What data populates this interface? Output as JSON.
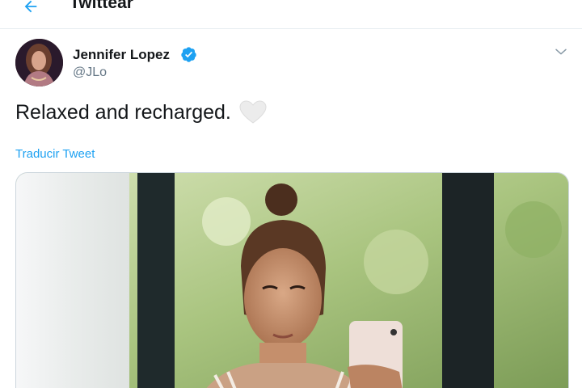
{
  "header": {
    "title": "Twittear",
    "back_icon": "arrow-left-icon"
  },
  "tweet": {
    "author": {
      "name": "Jennifer Lopez",
      "handle": "@JLo",
      "verified": true
    },
    "text": "Relaxed and recharged.",
    "emoji": "white-heart-icon",
    "translate_label": "Traducir Tweet",
    "menu_icon": "chevron-down-icon",
    "media_description": "photo"
  },
  "colors": {
    "accent": "#1da1f2",
    "handle": "#657786",
    "text": "#14171a",
    "border": "#e6ecf0"
  }
}
